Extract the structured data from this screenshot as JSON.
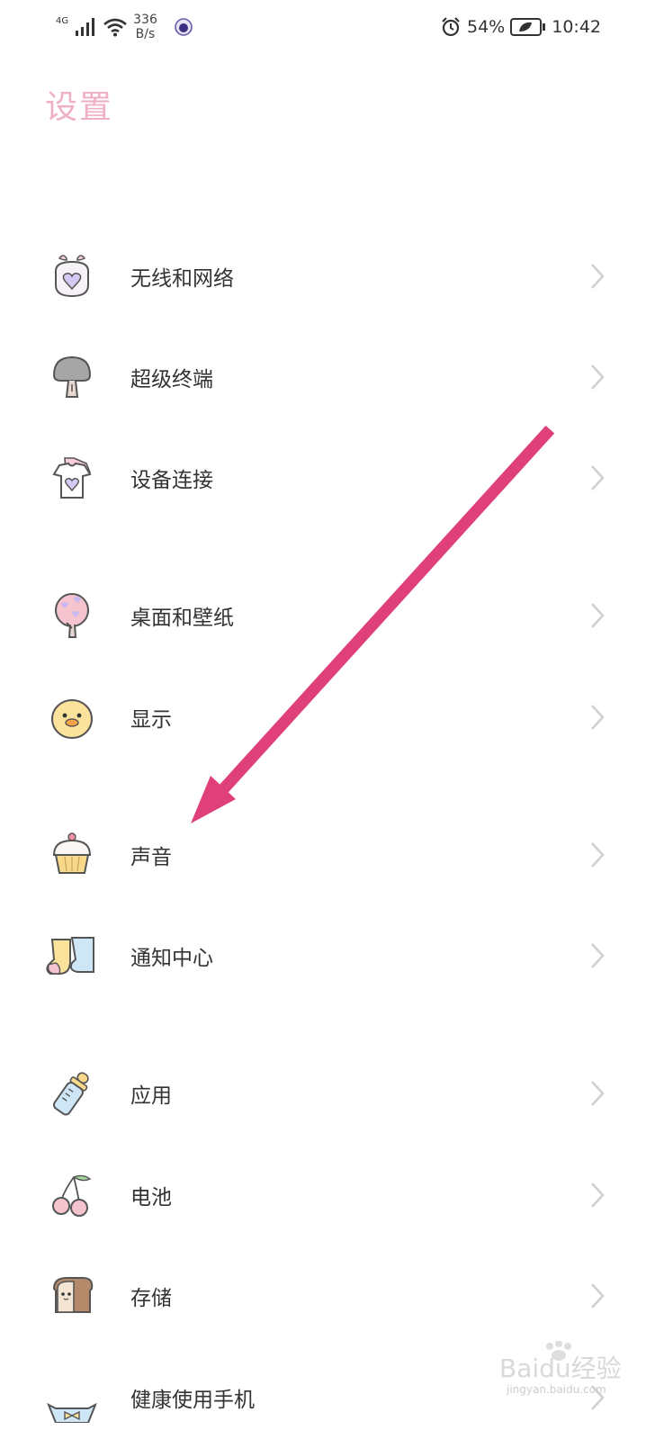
{
  "status_bar": {
    "network_type": "4G",
    "speed_value": "336",
    "speed_unit": "B/s",
    "battery": "54%",
    "time": "10:42"
  },
  "page": {
    "title": "设置"
  },
  "items": [
    {
      "label": "无线和网络",
      "icon": "heart-bag-icon"
    },
    {
      "label": "超级终端",
      "icon": "mushroom-tree-icon"
    },
    {
      "label": "设备连接",
      "icon": "tshirt-icon"
    },
    {
      "label": "桌面和壁纸",
      "icon": "heart-tree-icon"
    },
    {
      "label": "显示",
      "icon": "chick-face-icon"
    },
    {
      "label": "声音",
      "icon": "cupcake-icon"
    },
    {
      "label": "通知中心",
      "icon": "socks-icon"
    },
    {
      "label": "应用",
      "icon": "baby-bottle-icon"
    },
    {
      "label": "电池",
      "icon": "cherries-icon"
    },
    {
      "label": "存储",
      "icon": "toast-icon"
    },
    {
      "label": "健康使用手机",
      "icon": "bow-candy-icon"
    }
  ],
  "watermark": {
    "text": "Baidu经验",
    "sub": "jingyan.baidu.com"
  },
  "colors": {
    "title": "#f0b0c3",
    "arrow": "#e0407a",
    "chevron": "#cfcfcf"
  }
}
